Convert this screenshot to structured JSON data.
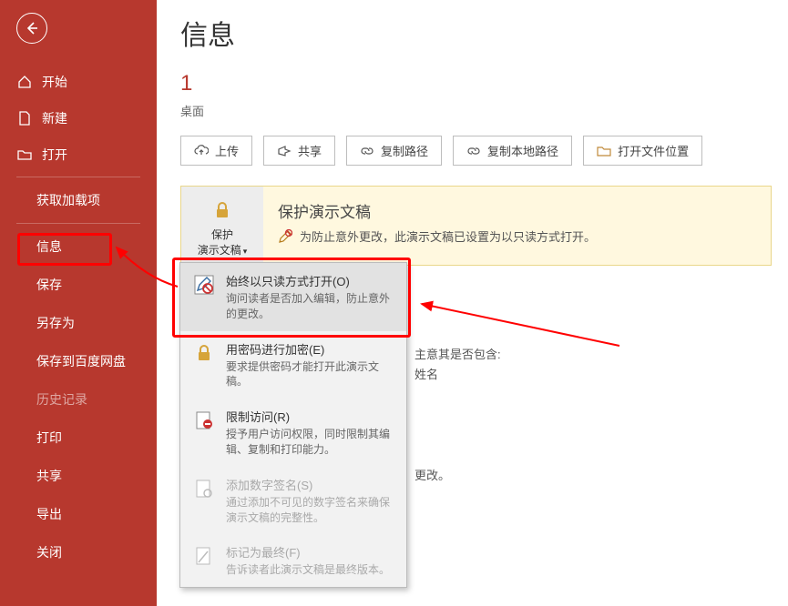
{
  "sidebar": {
    "items": [
      {
        "label": "开始"
      },
      {
        "label": "新建"
      },
      {
        "label": "打开"
      }
    ],
    "subitems": [
      {
        "label": "获取加载项"
      },
      {
        "label": "信息",
        "active": true
      },
      {
        "label": "保存"
      },
      {
        "label": "另存为"
      },
      {
        "label": "保存到百度网盘"
      },
      {
        "label": "历史记录",
        "dim": true
      },
      {
        "label": "打印"
      },
      {
        "label": "共享"
      },
      {
        "label": "导出"
      },
      {
        "label": "关闭"
      }
    ]
  },
  "page": {
    "title": "信息",
    "doc_title": "1",
    "doc_location": "桌面"
  },
  "toolbar": {
    "upload": "上传",
    "share": "共享",
    "copy_path": "复制路径",
    "copy_local": "复制本地路径",
    "open_location": "打开文件位置"
  },
  "protect": {
    "btn_line1": "保护",
    "btn_line2": "演示文稿",
    "title": "保护演示文稿",
    "desc": "为防止意外更改，此演示文稿已设置为以只读方式打开。"
  },
  "dropdown": [
    {
      "title": "始终以只读方式打开(O)",
      "desc": "询问读者是否加入编辑，防止意外的更改。",
      "highlight": true
    },
    {
      "title": "用密码进行加密(E)",
      "desc": "要求提供密码才能打开此演示文稿。"
    },
    {
      "title": "限制访问(R)",
      "desc": "授予用户访问权限，同时限制其编辑、复制和打印能力。"
    },
    {
      "title": "添加数字签名(S)",
      "desc": "通过添加不可见的数字签名来确保演示文稿的完整性。",
      "disabled": true
    },
    {
      "title": "标记为最终(F)",
      "desc": "告诉读者此演示文稿是最终版本。",
      "disabled": true
    }
  ],
  "side_info": {
    "line1": "主意其是否包含:",
    "line2": "姓名",
    "line3": "更改。"
  }
}
